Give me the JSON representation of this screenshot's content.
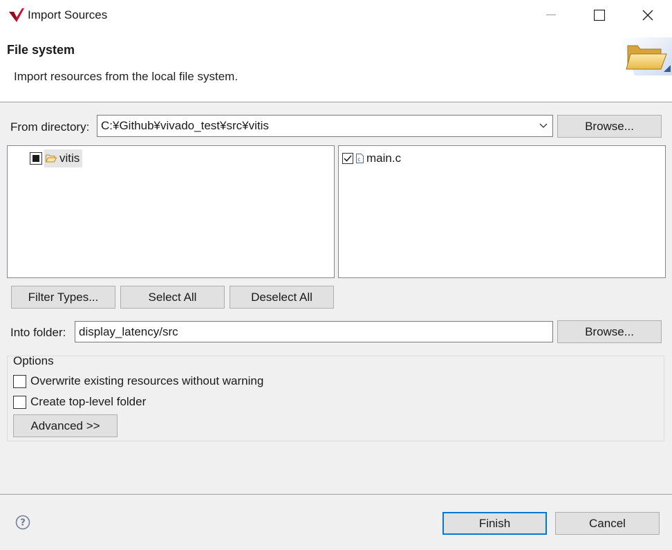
{
  "window": {
    "title": "Import Sources",
    "controls": [
      "minimize",
      "maximize",
      "close"
    ]
  },
  "header": {
    "title": "File system",
    "description": "Import resources from the local file system.",
    "banner_icon": "folder-icon"
  },
  "from_directory": {
    "label": "From directory:",
    "value": "C:¥Github¥vivado_test¥src¥vitis",
    "browse_label": "Browse..."
  },
  "tree": {
    "items": [
      {
        "label": "vitis",
        "state": "partial",
        "icon": "folder-open-icon",
        "selected": true
      }
    ]
  },
  "files": {
    "items": [
      {
        "label": "main.c",
        "checked": true,
        "icon": "c-file-icon"
      }
    ]
  },
  "selection_buttons": {
    "filter_types": "Filter Types...",
    "select_all": "Select All",
    "deselect_all": "Deselect All"
  },
  "into_folder": {
    "label": "Into folder:",
    "value": "display_latency/src",
    "browse_label": "Browse..."
  },
  "options": {
    "title": "Options",
    "overwrite_label": "Overwrite existing resources without warning",
    "overwrite_checked": false,
    "top_level_label": "Create top-level folder",
    "top_level_checked": false,
    "advanced_label": "Advanced >>"
  },
  "footer": {
    "finish_label": "Finish",
    "cancel_label": "Cancel"
  },
  "colors": {
    "accent": "#0078d7",
    "logo_red": "#c8102e"
  }
}
